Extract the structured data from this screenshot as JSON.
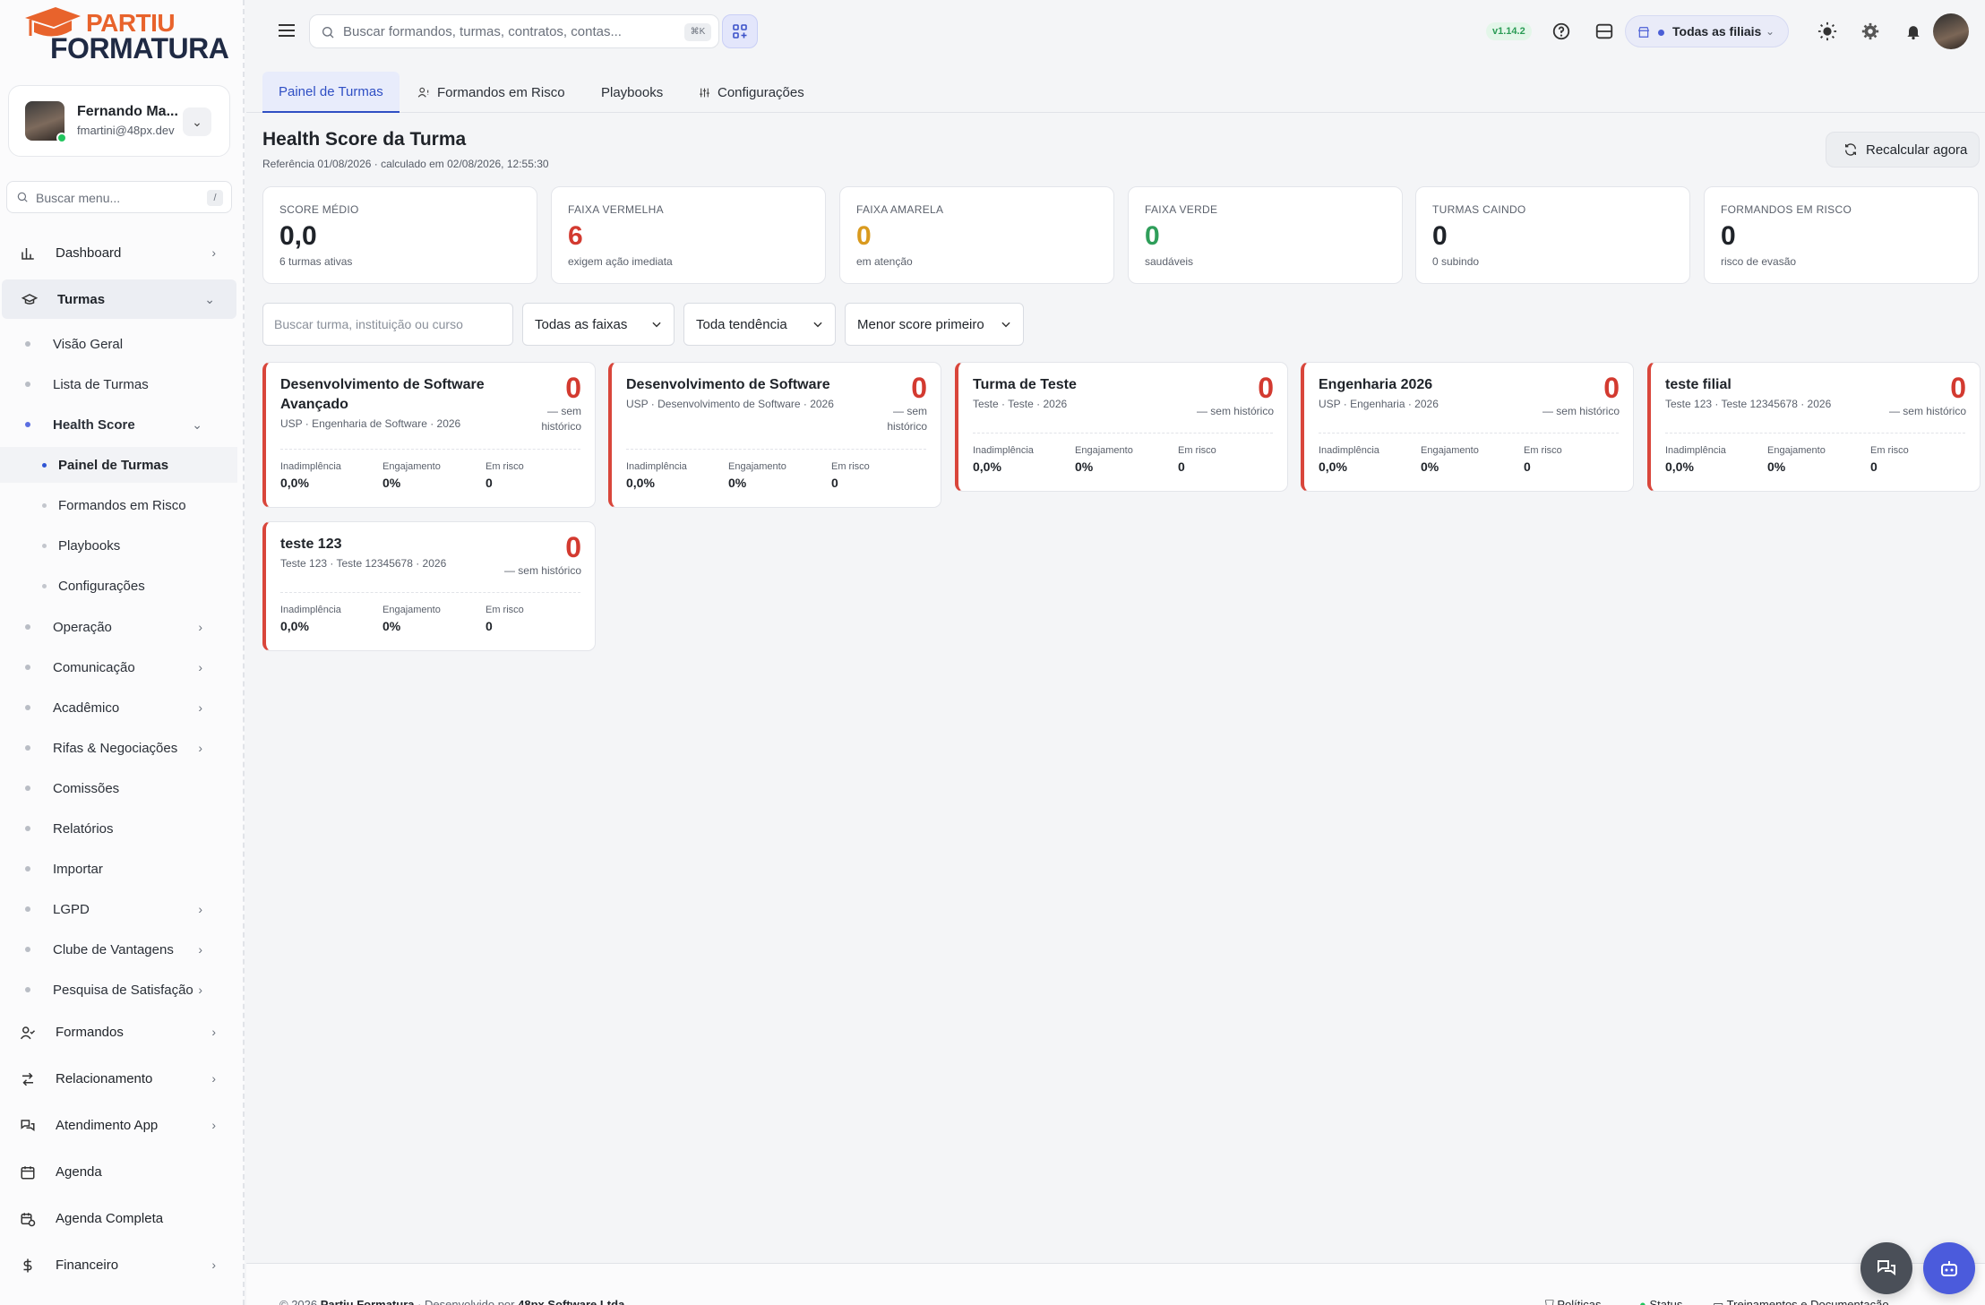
{
  "brand": {
    "line1": "PARTIU",
    "line2": "FORMATURA"
  },
  "user": {
    "name": "Fernando Ma...",
    "email": "fmartini@48px.dev"
  },
  "sidebar": {
    "search_placeholder": "Buscar menu...",
    "search_shortcut": "/",
    "items": [
      {
        "label": "Dashboard"
      },
      {
        "label": "Turmas"
      },
      {
        "label": "Formandos"
      },
      {
        "label": "Relacionamento"
      },
      {
        "label": "Atendimento App"
      },
      {
        "label": "Agenda"
      },
      {
        "label": "Agenda Completa"
      },
      {
        "label": "Financeiro"
      }
    ],
    "turmas_sub": [
      {
        "label": "Visão Geral"
      },
      {
        "label": "Lista de Turmas"
      },
      {
        "label": "Health Score"
      },
      {
        "label": "Operação"
      },
      {
        "label": "Comunicação"
      },
      {
        "label": "Acadêmico"
      },
      {
        "label": "Rifas & Negociações"
      },
      {
        "label": "Comissões"
      },
      {
        "label": "Relatórios"
      },
      {
        "label": "Importar"
      },
      {
        "label": "LGPD"
      },
      {
        "label": "Clube de Vantagens"
      },
      {
        "label": "Pesquisa de Satisfação"
      }
    ],
    "health_sub": [
      {
        "label": "Painel de Turmas"
      },
      {
        "label": "Formandos em Risco"
      },
      {
        "label": "Playbooks"
      },
      {
        "label": "Configurações"
      }
    ]
  },
  "topbar": {
    "search_placeholder": "Buscar formandos, turmas, contratos, contas...",
    "search_shortcut": "⌘K",
    "version": "v1.14.2",
    "branch_label": "Todas as filiais"
  },
  "tabs": [
    {
      "label": "Painel de Turmas"
    },
    {
      "label": "Formandos em Risco"
    },
    {
      "label": "Playbooks"
    },
    {
      "label": "Configurações"
    }
  ],
  "page": {
    "title": "Health Score da Turma",
    "subtitle": "Referência 01/08/2026 · calculado em 02/08/2026, 12:55:30",
    "recalc_label": "Recalcular agora"
  },
  "stats": [
    {
      "label": "SCORE MÉDIO",
      "value": "0,0",
      "sub": "6 turmas ativas",
      "color": "#1f2329"
    },
    {
      "label": "FAIXA VERMELHA",
      "value": "6",
      "sub": "exigem ação imediata",
      "color": "#d33a30"
    },
    {
      "label": "FAIXA AMARELA",
      "value": "0",
      "sub": "em atenção",
      "color": "#d99a1e"
    },
    {
      "label": "FAIXA VERDE",
      "value": "0",
      "sub": "saudáveis",
      "color": "#2f9e5a"
    },
    {
      "label": "TURMAS CAINDO",
      "value": "0",
      "sub": "0 subindo",
      "color": "#1f2329"
    },
    {
      "label": "FORMANDOS EM RISCO",
      "value": "0",
      "sub": "risco de evasão",
      "color": "#1f2329"
    }
  ],
  "filters": {
    "search_placeholder": "Buscar turma, instituição ou curso",
    "band": "Todas as faixas",
    "trend": "Toda tendência",
    "sort": "Menor score primeiro"
  },
  "metric_labels": {
    "default": "Inadimplência",
    "engagement": "Engajamento",
    "risk": "Em risco"
  },
  "classes": [
    {
      "name": "Desenvolvimento de Software Avançado",
      "meta": "USP · Engenharia de Software · 2026",
      "score": "0",
      "trend": "— sem histórico",
      "default": "0,0%",
      "engagement": "0%",
      "risk": "0"
    },
    {
      "name": "Desenvolvimento de Software",
      "meta": "USP · Desenvolvimento de Software · 2026",
      "score": "0",
      "trend": "— sem histórico",
      "default": "0,0%",
      "engagement": "0%",
      "risk": "0"
    },
    {
      "name": "Turma de Teste",
      "meta": "Teste · Teste · 2026",
      "score": "0",
      "trend": "— sem histórico",
      "default": "0,0%",
      "engagement": "0%",
      "risk": "0"
    },
    {
      "name": "Engenharia 2026",
      "meta": "USP · Engenharia · 2026",
      "score": "0",
      "trend": "— sem histórico",
      "default": "0,0%",
      "engagement": "0%",
      "risk": "0"
    },
    {
      "name": "teste filial",
      "meta": "Teste 123 · Teste 12345678 · 2026",
      "score": "0",
      "trend": "— sem histórico",
      "default": "0,0%",
      "engagement": "0%",
      "risk": "0"
    },
    {
      "name": "teste 123",
      "meta": "Teste 123 · Teste 12345678 · 2026",
      "score": "0",
      "trend": "— sem histórico",
      "default": "0,0%",
      "engagement": "0%",
      "risk": "0"
    }
  ],
  "footer": {
    "copyright": "© 2026 ",
    "company": "Partiu Formatura",
    "dev_prefix": " · Desenvolvido por ",
    "dev": "48px Software Ltda",
    "policies": "Políticas",
    "status": "Status",
    "training": "Treinamentos e Documentação"
  },
  "colors": {
    "accent": "#2f4fc4",
    "danger": "#d33a30",
    "warning": "#d99a1e",
    "success": "#2f9e5a",
    "brand_orange": "#e8632c"
  }
}
